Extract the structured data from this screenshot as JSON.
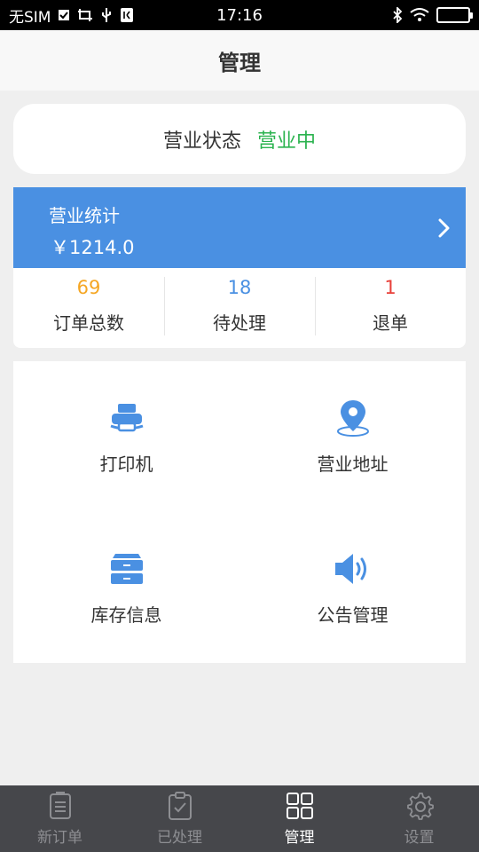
{
  "status_bar": {
    "carrier": "无SIM",
    "time": "17:16"
  },
  "header": {
    "title": "管理"
  },
  "business_status": {
    "label": "营业状态",
    "value": "营业中"
  },
  "stats": {
    "title": "营业统计",
    "amount": "￥1214.0",
    "counts": [
      {
        "value": "69",
        "label": "订单总数",
        "color": "#f5a623"
      },
      {
        "value": "18",
        "label": "待处理",
        "color": "#4a90e2"
      },
      {
        "value": "1",
        "label": "退单",
        "color": "#e8403a"
      }
    ]
  },
  "grid": {
    "items": [
      {
        "label": "打印机",
        "icon": "printer-icon"
      },
      {
        "label": "营业地址",
        "icon": "location-pin-icon"
      },
      {
        "label": "库存信息",
        "icon": "inventory-drawer-icon"
      },
      {
        "label": "公告管理",
        "icon": "speaker-icon"
      }
    ]
  },
  "tabbar": {
    "tabs": [
      {
        "label": "新订单",
        "icon": "new-order-icon",
        "active": false
      },
      {
        "label": "已处理",
        "icon": "clipboard-check-icon",
        "active": false
      },
      {
        "label": "管理",
        "icon": "grid-icon",
        "active": true
      },
      {
        "label": "设置",
        "icon": "gear-icon",
        "active": false
      }
    ]
  },
  "colors": {
    "accent_blue": "#4a90e2",
    "status_green": "#2bb34f",
    "tabbar_bg": "#46474b"
  }
}
